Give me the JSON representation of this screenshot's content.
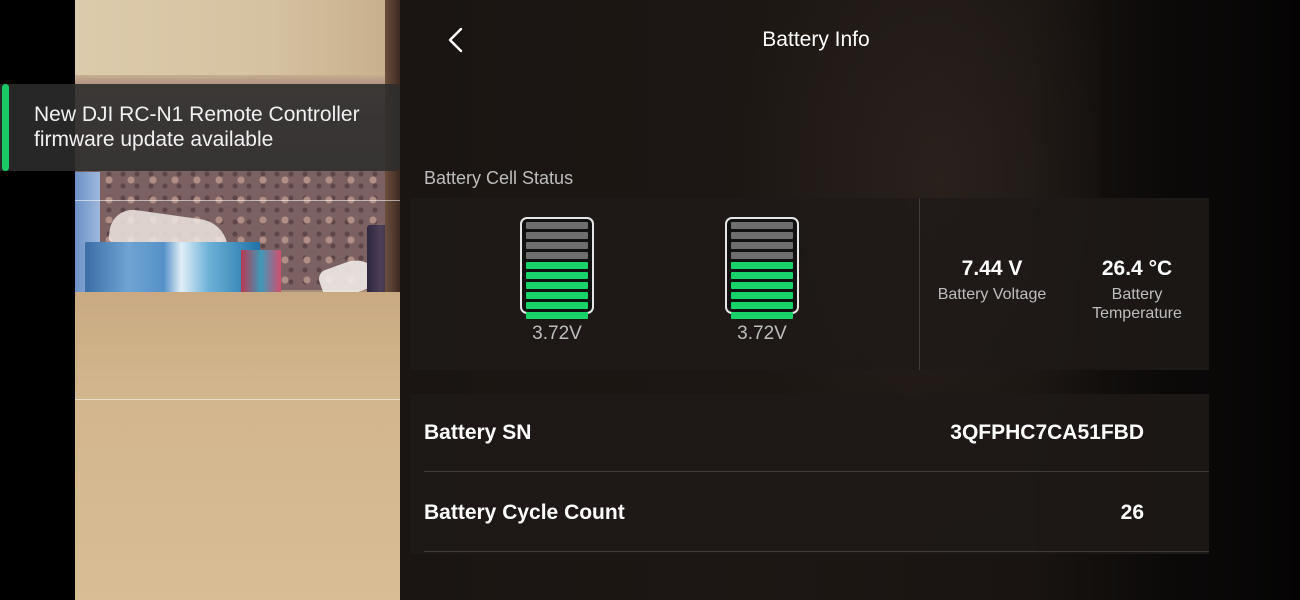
{
  "notification": {
    "line1": "New DJI RC-N1 Remote Controller",
    "line2": "firmware update available"
  },
  "header": {
    "title": "Battery Info",
    "back_icon": "chevron-left-icon"
  },
  "cell_status": {
    "section_label": "Battery Cell Status",
    "cells": [
      {
        "voltage": "3.72V",
        "level": 0.6
      },
      {
        "voltage": "3.72V",
        "level": 0.6
      }
    ],
    "total_segments": 10
  },
  "stats": {
    "voltage_value": "7.44 V",
    "voltage_label": "Battery Voltage",
    "temperature_value": "26.4 °C",
    "temperature_label_line1": "Battery",
    "temperature_label_line2": "Temperature"
  },
  "info_rows": [
    {
      "label": "Battery SN",
      "value": "3QFPHC7CA51FBD"
    },
    {
      "label": "Battery Cycle Count",
      "value": "26"
    }
  ],
  "colors": {
    "accent": "#19c964",
    "cell_filled": "#19d36a",
    "cell_empty": "#6e6e6e"
  }
}
